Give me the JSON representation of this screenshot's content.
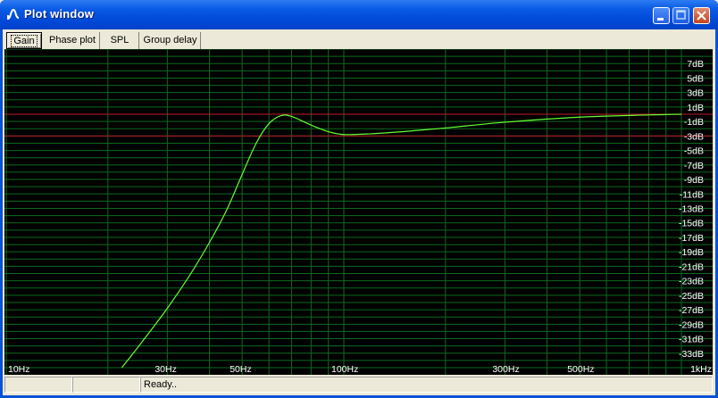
{
  "window": {
    "title": "Plot window",
    "icon": "wave-icon"
  },
  "tabs": [
    {
      "label": "Gain",
      "active": true
    },
    {
      "label": "Phase plot",
      "active": false
    },
    {
      "label": "SPL",
      "active": false
    },
    {
      "label": "Group delay",
      "active": false
    }
  ],
  "status": {
    "pane1": "",
    "pane2": "",
    "pane3": "Ready.."
  },
  "colors": {
    "background": "#000000",
    "grid": "#0D6B1E",
    "curve": "#66FF33",
    "reference": "#C0182A",
    "labels": "#FFFFFF"
  },
  "chart_data": {
    "type": "line",
    "x_scale": "log",
    "xlim": [
      10,
      1000
    ],
    "ylim": [
      -35,
      9
    ],
    "x_tick_labels": [
      {
        "x": 10,
        "label": "10Hz"
      },
      {
        "x": 30,
        "label": "30Hz"
      },
      {
        "x": 50,
        "label": "50Hz"
      },
      {
        "x": 100,
        "label": "100Hz"
      },
      {
        "x": 300,
        "label": "300Hz"
      },
      {
        "x": 500,
        "label": "500Hz"
      },
      {
        "x": 1000,
        "label": "1kHz"
      }
    ],
    "y_tick_labels": [
      "7dB",
      "5dB",
      "3dB",
      "1dB",
      "-1dB",
      "-3dB",
      "-5dB",
      "-7dB",
      "-9dB",
      "-11dB",
      "-13dB",
      "-15dB",
      "-17dB",
      "-19dB",
      "-21dB",
      "-23dB",
      "-25dB",
      "-27dB",
      "-29dB",
      "-31dB",
      "-33dB"
    ],
    "y_tick_values": [
      7,
      5,
      3,
      1,
      -1,
      -3,
      -5,
      -7,
      -9,
      -11,
      -13,
      -15,
      -17,
      -19,
      -21,
      -23,
      -25,
      -27,
      -29,
      -31,
      -33
    ],
    "reference_lines": [
      0,
      -3
    ],
    "series": [
      {
        "x": [
          22,
          25,
          30,
          35,
          40,
          45,
          50,
          55,
          60,
          65,
          70,
          80,
          90,
          100,
          120,
          150,
          200,
          300,
          500,
          800,
          1000
        ],
        "y": [
          -35,
          -31.7,
          -26.8,
          -22.2,
          -17.7,
          -13.2,
          -8.3,
          -4,
          -1.3,
          -0.2,
          -0.3,
          -1.5,
          -2.4,
          -2.8,
          -2.7,
          -2.4,
          -1.9,
          -1.1,
          -0.4,
          -0.1,
          0
        ]
      }
    ]
  }
}
